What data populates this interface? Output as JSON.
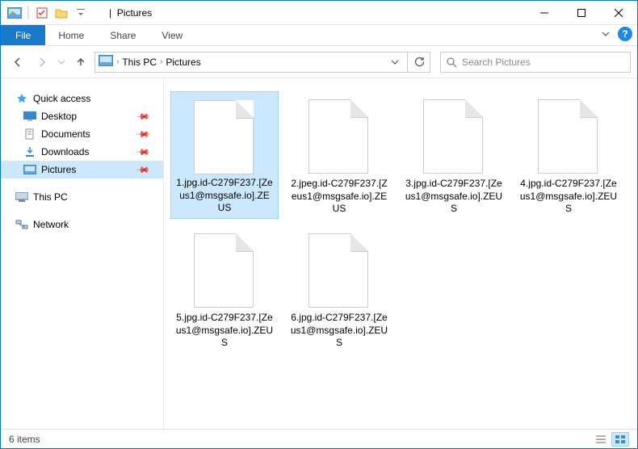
{
  "window": {
    "title": "Pictures",
    "title_separator": "|"
  },
  "ribbon": {
    "file": "File",
    "tabs": [
      "Home",
      "Share",
      "View"
    ]
  },
  "breadcrumbs": {
    "items": [
      "This PC",
      "Pictures"
    ]
  },
  "search": {
    "placeholder": "Search Pictures"
  },
  "sidebar": {
    "quick_access": "Quick access",
    "items": [
      {
        "label": "Desktop",
        "pinned": true
      },
      {
        "label": "Documents",
        "pinned": true
      },
      {
        "label": "Downloads",
        "pinned": true
      },
      {
        "label": "Pictures",
        "pinned": true,
        "selected": true
      }
    ],
    "this_pc": "This PC",
    "network": "Network"
  },
  "files": [
    {
      "name": "1.jpg.id-C279F237.[Zeus1@msgsafe.io].ZEUS",
      "selected": true
    },
    {
      "name": "2.jpeg.id-C279F237.[Zeus1@msgsafe.io].ZEUS"
    },
    {
      "name": "3.jpg.id-C279F237.[Zeus1@msgsafe.io].ZEUS"
    },
    {
      "name": "4.jpg.id-C279F237.[Zeus1@msgsafe.io].ZEUS"
    },
    {
      "name": "5.jpg.id-C279F237.[Zeus1@msgsafe.io].ZEUS"
    },
    {
      "name": "6.jpg.id-C279F237.[Zeus1@msgsafe.io].ZEUS"
    }
  ],
  "status": {
    "count": "6 items"
  },
  "colors": {
    "accent": "#0078d7",
    "selection": "#cce8ff"
  }
}
